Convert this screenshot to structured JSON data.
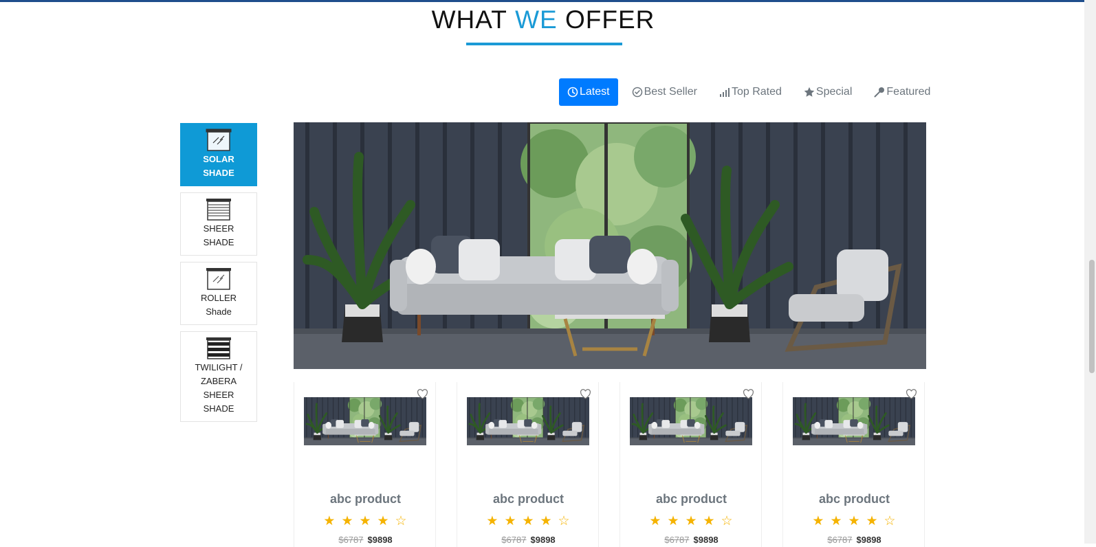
{
  "section": {
    "title_part1": "WHAT",
    "title_part2": "WE",
    "title_part3": "OFFER",
    "accent_color": "#1a9ad6"
  },
  "tabs": [
    {
      "label": "Latest",
      "icon": "clock-icon",
      "active": true
    },
    {
      "label": "Best Seller",
      "icon": "check-circle-icon",
      "active": false
    },
    {
      "label": "Top Rated",
      "icon": "signal-bars-icon",
      "active": false
    },
    {
      "label": "Special",
      "icon": "star-icon",
      "active": false
    },
    {
      "label": "Featured",
      "icon": "key-icon",
      "active": false
    }
  ],
  "sidebar": {
    "items": [
      {
        "label_line1": "SOLAR",
        "label_line2": "SHADE",
        "icon": "solar-shade-icon",
        "active": true
      },
      {
        "label_line1": "SHEER",
        "label_line2": "SHADE",
        "icon": "sheer-shade-icon",
        "active": false
      },
      {
        "label_line1": "ROLLER",
        "label_line2": "Shade",
        "icon": "roller-shade-icon",
        "active": false
      },
      {
        "label_line1": "TWILIGHT /",
        "label_line2": "ZABERA",
        "label_line3": "SHEER",
        "label_line4": "SHADE",
        "icon": "twilight-shade-icon",
        "active": false
      }
    ]
  },
  "products": [
    {
      "name": "abc product",
      "rating": 4,
      "max_rating": 5,
      "old_price": "$6787",
      "price": "$9898"
    },
    {
      "name": "abc product",
      "rating": 4,
      "max_rating": 5,
      "old_price": "$6787",
      "price": "$9898"
    },
    {
      "name": "abc product",
      "rating": 4,
      "max_rating": 5,
      "old_price": "$6787",
      "price": "$9898"
    },
    {
      "name": "abc product",
      "rating": 4,
      "max_rating": 5,
      "old_price": "$6787",
      "price": "$9898"
    }
  ],
  "colors": {
    "active_tab": "#007bff",
    "active_sidebar": "#0f9ad6",
    "star": "#f5b301",
    "top_bar": "#1f4e8c"
  }
}
